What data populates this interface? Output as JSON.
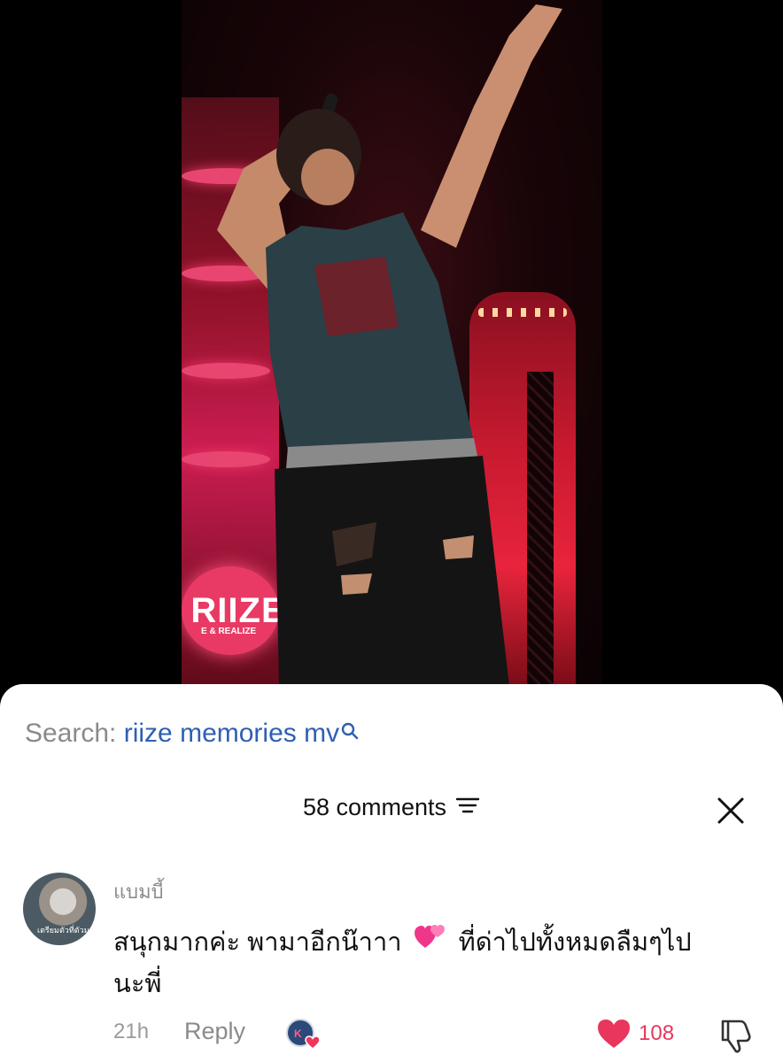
{
  "video": {
    "logo_text": "RIIZE",
    "logo_sub": "E & REALIZE"
  },
  "search": {
    "prefix": "Search: ",
    "term": "riize memories mv"
  },
  "comments": {
    "count_label": "58 comments"
  },
  "comment": {
    "avatar_tag": "เตรียมตัวที่ตัวมาก",
    "username": "แบมบี้",
    "text_part1": "สนุกมากค่ะ พามาอีกน๊าาา",
    "emoji": "hearts-emoji",
    "text_part2": "ที่ด่าไปทั้งหมดลืมๆไป",
    "text_line2": "นะพี่",
    "time": "21h",
    "reply_label": "Reply",
    "like_count": "108"
  },
  "colors": {
    "search_term": "#2f5fb3",
    "like": "#e8365d"
  }
}
